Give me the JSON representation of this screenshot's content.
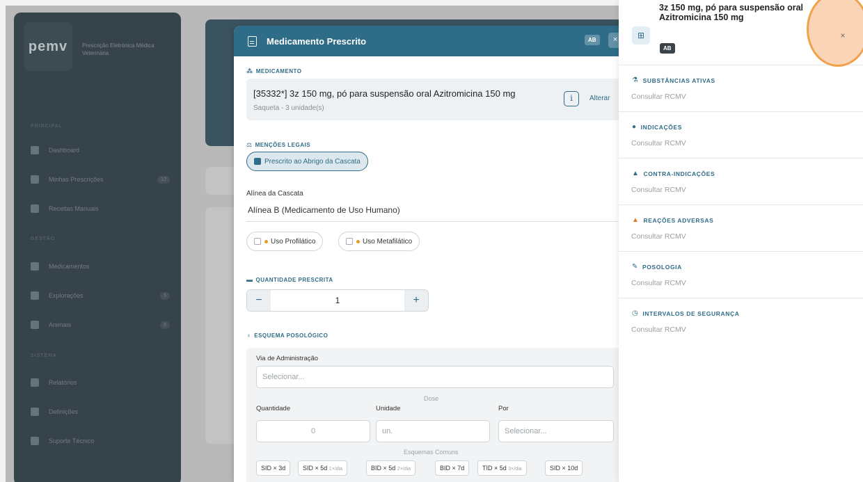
{
  "background": {
    "logo": "pemv",
    "logo_sub": "Prescrição Eletrónica Médica Veterinária",
    "section_main": "PRINCIPAL",
    "section_mgmt": "GESTÃO",
    "section_system": "SISTEMA",
    "nav": [
      {
        "label": "Dashboard",
        "count": ""
      },
      {
        "label": "Minhas Prescrições",
        "count": "12"
      },
      {
        "label": "Receitas Manuais",
        "count": ""
      },
      {
        "label": "Medicamentos",
        "count": ""
      },
      {
        "label": "Explorações",
        "count": "5"
      },
      {
        "label": "Animais",
        "count": "8"
      },
      {
        "label": "Relatórios",
        "count": ""
      },
      {
        "label": "Definições",
        "count": ""
      },
      {
        "label": "Suporte Técnico",
        "count": ""
      }
    ]
  },
  "modal": {
    "title": "Medicamento Prescrito",
    "badge": "AB",
    "close": "×",
    "medication_section": "MEDICAMENTO",
    "medication_name": "[35332*] 3z 150 mg, pó para suspensão oral Azitromicina 150 mg",
    "medication_sub": "Saqueta - 3 unidade(s)",
    "info_icon": "i",
    "alterar": "Alterar",
    "legal_section": "MENÇÕES LEGAIS",
    "cascade_pill": "Prescrito ao Abrigo da Cascata",
    "cascade_field_label": "Alínea da Cascata",
    "cascade_field_value": "Alínea B (Medicamento de Uso Humano)",
    "prophylactic": "Uso Profilático",
    "metaphylactic": "Uso Metafilático",
    "quantity_section": "QUANTIDADE PRESCRITA",
    "quantity_minus": "−",
    "quantity_value": "1",
    "quantity_plus": "+",
    "posology_section": "ESQUEMA POSOLÓGICO",
    "route_label": "Via de Administração",
    "route_placeholder": "Selecionar...",
    "dose_label": "Dose",
    "qty_label": "Quantidade",
    "qty_value": "0",
    "unit_label": "Unidade",
    "unit_value": "un.",
    "per_label": "Por",
    "per_placeholder": "Selecionar...",
    "common_label": "Esquemas Comuns",
    "chips": [
      {
        "main": "SID × 3d",
        "sub": ""
      },
      {
        "main": "SID × 5d",
        "sub": "1×/dia"
      },
      {
        "main": "BID × 5d",
        "sub": "2×/dia"
      },
      {
        "main": "BID × 7d",
        "sub": ""
      },
      {
        "main": "TID × 5d",
        "sub": "3×/dia"
      },
      {
        "main": "SID × 10d",
        "sub": ""
      }
    ]
  },
  "panel": {
    "title": "3z 150 mg, pó para suspensão oral Azitromicina 150 mg",
    "badge": "AB",
    "close": "×",
    "sections": [
      {
        "title": "SUBSTÂNCIAS ATIVAS",
        "value": "Consultar RCMV",
        "icon": "flask-icon",
        "glyph": "⚗",
        "color": "#2f6c87"
      },
      {
        "title": "INDICAÇÕES",
        "value": "Consultar RCMV",
        "icon": "check-circle-icon",
        "glyph": "●",
        "color": "#2f6c87"
      },
      {
        "title": "CONTRA-INDICAÇÕES",
        "value": "Consultar RCMV",
        "icon": "warning-icon",
        "glyph": "▲",
        "color": "#2f6c87"
      },
      {
        "title": "REAÇÕES ADVERSAS",
        "value": "Consultar RCMV",
        "icon": "alert-icon",
        "glyph": "▲",
        "color": "#e07b2e"
      },
      {
        "title": "POSOLOGIA",
        "value": "Consultar RCMV",
        "icon": "syringe-icon",
        "glyph": "✎",
        "color": "#2f6c87"
      },
      {
        "title": "INTERVALOS DE SEGURANÇA",
        "value": "Consultar RCMV",
        "icon": "clock-icon",
        "glyph": "◷",
        "color": "#2f6c87"
      }
    ]
  }
}
